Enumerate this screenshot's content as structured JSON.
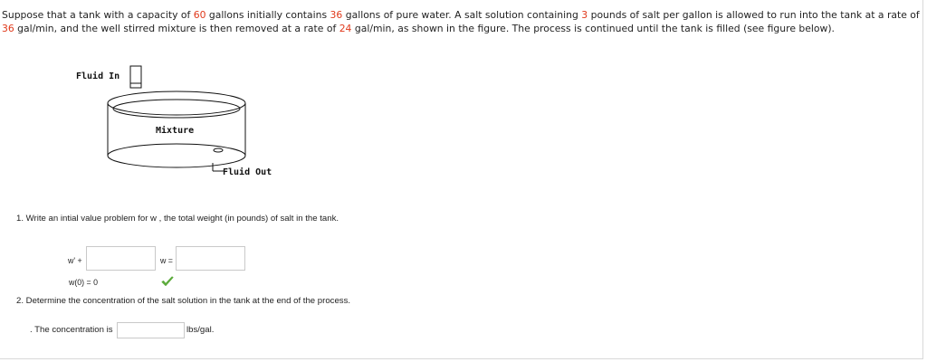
{
  "problem": {
    "p1": "Suppose that a tank with a capacity of ",
    "capacity": "60",
    "p2": " gallons initially contains ",
    "initial": "36",
    "p3": " gallons of pure water. A salt solution containing ",
    "salt": "3",
    "p4": " pounds of salt per gallon is allowed to run into the tank at a rate of ",
    "rate_in": "36",
    "p5": " gal/min, and the well stirred mixture is then removed at a rate of ",
    "rate_out": "24",
    "p6": " gal/min, as shown in the figure. The process is continued until the tank is filled (see figure below)."
  },
  "figure": {
    "fluid_in": "Fluid In",
    "mixture": "Mixture",
    "fluid_out": "Fluid Out"
  },
  "q1": {
    "text": "1.  Write an intial value problem for  w , the total weight (in pounds) of salt in the tank.",
    "lhs_label": "w' +",
    "eq_label": "w =",
    "input1_value": "",
    "input2_value": "",
    "initial_condition": "w(0) = 0"
  },
  "q2": {
    "text": "2.  Determine the concentration of the salt solution in the tank at the end of the process.",
    "prefix": ". The concentration is",
    "input_value": "",
    "units": "lbs/gal."
  },
  "colors": {
    "highlight": "#e0391b",
    "check": "#5cab3c"
  },
  "icons": {
    "correct": "checkmark-icon"
  }
}
